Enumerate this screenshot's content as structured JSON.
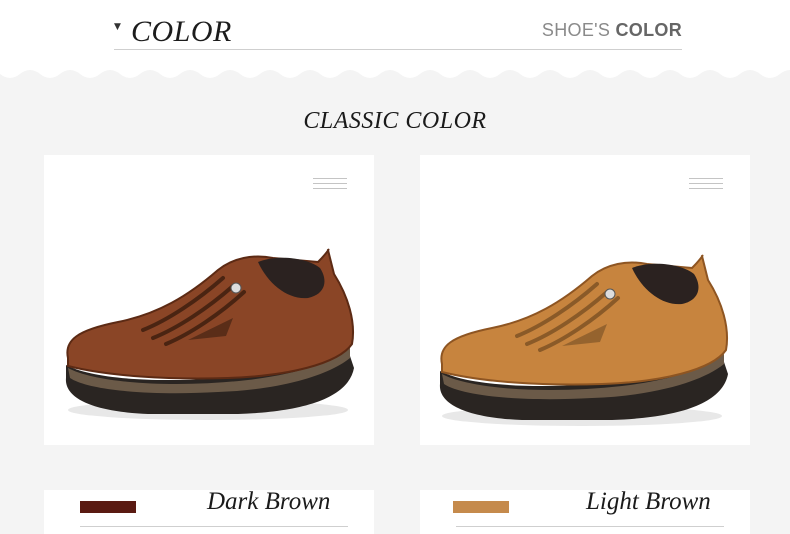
{
  "header": {
    "title": "COLOR",
    "right_prefix": "SHOE'S",
    "right_strong": "COLOR"
  },
  "section": {
    "title": "CLASSIC COLOR"
  },
  "products": [
    {
      "name": "Dark Brown",
      "swatch_color": "#5a1a12",
      "shoe_color": "#8a4526",
      "shoe_shade": "#5c2a14"
    },
    {
      "name": "Light Brown",
      "swatch_color": "#c58a4c",
      "shoe_color": "#c7843e",
      "shoe_shade": "#8e5522"
    }
  ]
}
